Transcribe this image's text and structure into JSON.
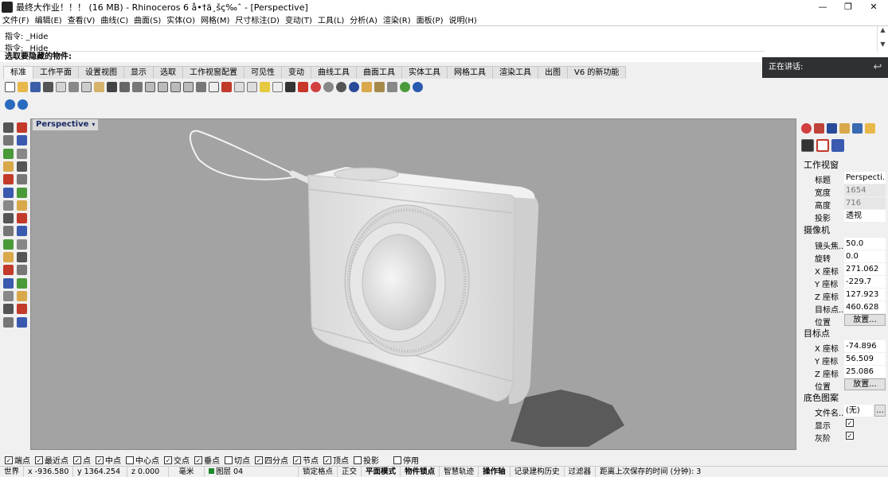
{
  "window": {
    "title": "最终大作业！！！ (16 MB) - Rhinoceros 6 å•†ä¸šç‰ˆ - [Perspective]",
    "controls": [
      "—",
      "❐",
      "✕"
    ]
  },
  "menu": [
    "文件(F)",
    "编辑(E)",
    "查看(V)",
    "曲线(C)",
    "曲面(S)",
    "实体(O)",
    "网格(M)",
    "尺寸标注(D)",
    "变动(T)",
    "工具(L)",
    "分析(A)",
    "渲染(R)",
    "面板(P)",
    "说明(H)"
  ],
  "command": {
    "history": [
      "指令: _Hide",
      "指令: _Hide"
    ],
    "prompt": "选取要隐藏的物件:"
  },
  "speaking": {
    "label": "正在讲话:"
  },
  "tabs": [
    {
      "label": "标准",
      "active": true
    },
    {
      "label": "工作平面"
    },
    {
      "label": "设置视图"
    },
    {
      "label": "显示"
    },
    {
      "label": "选取"
    },
    {
      "label": "工作视窗配置"
    },
    {
      "label": "可见性"
    },
    {
      "label": "变动"
    },
    {
      "label": "曲线工具"
    },
    {
      "label": "曲面工具"
    },
    {
      "label": "实体工具"
    },
    {
      "label": "网格工具"
    },
    {
      "label": "渲染工具"
    },
    {
      "label": "出图"
    },
    {
      "label": "V6 的新功能"
    }
  ],
  "viewport": {
    "label": "Perspective",
    "dropdown": "▾"
  },
  "panel": {
    "section_viewport": "工作视窗",
    "title_label": "标题",
    "title_value": "Perspecti...",
    "width_label": "宽度",
    "width_value": "1654",
    "height_label": "高度",
    "height_value": "716",
    "projection_label": "投影",
    "projection_value": "透视",
    "section_camera": "摄像机",
    "lens_label": "镜头焦...",
    "lens_value": "50.0",
    "rotate_label": "旋转",
    "rotate_value": "0.0",
    "cx_label": "X 座标",
    "cx_value": "271.062",
    "cy_label": "Y 座标",
    "cy_value": "-229.7",
    "cz_label": "Z 座标",
    "cz_value": "127.923",
    "tdist_label": "目标点...",
    "tdist_value": "460.628",
    "cpos_label": "位置",
    "cpos_button": "放置...",
    "section_target": "目标点",
    "tx_label": "X 座标",
    "tx_value": "-74.896",
    "ty_label": "Y 座标",
    "ty_value": "56.509",
    "tz_label": "Z 座标",
    "tz_value": "25.086",
    "tpos_label": "位置",
    "tpos_button": "放置...",
    "section_wallpaper": "底色图案",
    "file_label": "文件名...",
    "file_value": "(无)",
    "file_button": "...",
    "show_label": "显示",
    "gray_label": "灰阶"
  },
  "osnaps": [
    {
      "label": "端点",
      "checked": true
    },
    {
      "label": "最近点",
      "checked": true
    },
    {
      "label": "点",
      "checked": true
    },
    {
      "label": "中点",
      "checked": true
    },
    {
      "label": "中心点",
      "checked": false
    },
    {
      "label": "交点",
      "checked": true
    },
    {
      "label": "垂点",
      "checked": true
    },
    {
      "label": "切点",
      "checked": false
    },
    {
      "label": "四分点",
      "checked": true
    },
    {
      "label": "节点",
      "checked": true
    },
    {
      "label": "顶点",
      "checked": true
    },
    {
      "label": "投影",
      "checked": false
    },
    {
      "label": "停用",
      "checked": false
    }
  ],
  "status": {
    "cplane": "世界",
    "x": "x -936.580",
    "y": "y 1364.254",
    "z": "z 0.000",
    "units": "毫米",
    "layer": "图层 04",
    "gridsnap": "锁定格点",
    "ortho": "正交",
    "planar": "平面模式",
    "osnap": "物件锁点",
    "smarttrack": "智慧轨迹",
    "gumball": "操作轴",
    "history": "记录建构历史",
    "filter": "过滤器",
    "autosave": "距离上次保存的时间 (分钟): 3"
  },
  "colors": {
    "viewport_bg": "#a3a3a3",
    "model": "#e9e9e9",
    "shadow": "#5a5a5a",
    "layer": "#1a8a2a"
  }
}
